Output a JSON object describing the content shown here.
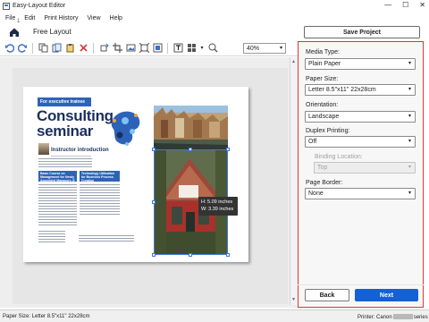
{
  "window": {
    "title": "Easy-Layout Editor",
    "minimize_glyph": "—",
    "maximize_glyph": "☐",
    "close_glyph": "✕"
  },
  "menu": [
    "File",
    "Edit",
    "Print History",
    "View",
    "Help"
  ],
  "nav": {
    "label": "Free Layout",
    "save_label": "Save Project"
  },
  "toolbar": {
    "zoom": "40%",
    "zoom_caret": "▾"
  },
  "canvas": {
    "page_number": "1",
    "brochure": {
      "banner": "For executive trainee",
      "title_line1": "Consulting",
      "title_line2": "seminar",
      "subtitle": "Instructor introduction",
      "box1": "Basic Course on Management for Newly Appointed Managers (2 days course)",
      "box2": "Technology Utilization for Business Process Creation"
    },
    "selection_tip": {
      "height": "H: 5.09 inches",
      "width": "W: 3.39 inches"
    }
  },
  "panel": {
    "media_type": {
      "label": "Media Type:",
      "value": "Plain Paper"
    },
    "paper_size": {
      "label": "Paper Size:",
      "value": "Letter 8.5\"x11\" 22x28cm"
    },
    "orientation": {
      "label": "Orientation:",
      "value": "Landscape"
    },
    "duplex": {
      "label": "Duplex Printing:",
      "value": "Off"
    },
    "binding": {
      "label": "Binding Location:",
      "value": "Top"
    },
    "border": {
      "label": "Page Border:",
      "value": "None"
    },
    "caret": "▾"
  },
  "buttons": {
    "back": "Back",
    "next": "Next"
  },
  "status": {
    "paper": "Paper Size: Letter 8.5\"x11\" 22x28cm",
    "printer_prefix": "Printer: Canon",
    "printer_suffix": "series"
  },
  "colors": {
    "accent": "#1460d6",
    "panel_border": "#e03434",
    "brochure_navy": "#1b2f5e",
    "brochure_blue": "#2c63b8"
  }
}
